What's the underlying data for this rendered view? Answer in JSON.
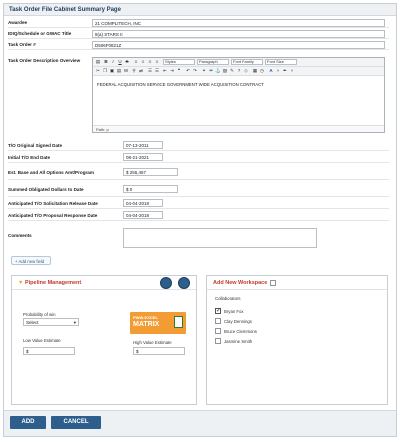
{
  "page": {
    "title": "Task Order File Cabinet Summary Page"
  },
  "fields": [
    {
      "label": "Awardee",
      "value": "21 COMPLITECH, INC"
    },
    {
      "label": "IDIQ/Schedule or GWAC Title",
      "value": "8(a) STARS II"
    },
    {
      "label": "Task Order #",
      "value": "D506F0821Z"
    },
    {
      "label": "Task Order Description Overview",
      "value": ""
    }
  ],
  "editor": {
    "style_select": "Styles",
    "paragraph_select": "Paragraph",
    "font_family_select": "Font Family",
    "font_size_select": "Font Size",
    "content": "FEDERAL ACQUISITION SERVICE GOVERNMENT WIDE ACQUISITION CONTRACT",
    "path": "Path: p"
  },
  "dates": [
    {
      "label": "T/O Original Signed Date",
      "value": "07-13-2011"
    },
    {
      "label": "Initial T/O End Date",
      "value": "08-21-2021"
    },
    {
      "label": "Est. Base and All Options Amt/Program",
      "value": "$ 255,457"
    },
    {
      "label": "Summed Obligated Dollars to Date",
      "value": "$ 0"
    },
    {
      "label": "Anticipated T/O Solicitation Release Date",
      "value": "04-04-2018"
    },
    {
      "label": "Anticipated T/O Proposal Response Date",
      "value": "04-04-2018"
    },
    {
      "label": "Comments",
      "value": ""
    }
  ],
  "add_field": "+ Add new field",
  "pipeline": {
    "title": "Pipeline Management",
    "prob_label": "Probability of win",
    "prob_value": "Select",
    "low_label": "Low Value Estimate",
    "low_value": "$",
    "high_label": "High Value Estimate",
    "high_value": "$",
    "matrix_line1": "PWIN EXCEL",
    "matrix_line2": "MATRIX"
  },
  "workspace": {
    "title": "Add New Workspace",
    "collab_label": "Collaborators",
    "collaborators": [
      {
        "name": "Bryan Fox",
        "checked": true
      },
      {
        "name": "Clay Dennings",
        "checked": false
      },
      {
        "name": "Bruce Clemmons",
        "checked": false
      },
      {
        "name": "Jasmine Smith",
        "checked": false
      }
    ]
  },
  "buttons": {
    "add": "ADD",
    "cancel": "CANCEL"
  },
  "colors": {
    "accent": "#2d5e8c",
    "header_red": "#c0392b",
    "matrix_orange": "#f39c34"
  }
}
